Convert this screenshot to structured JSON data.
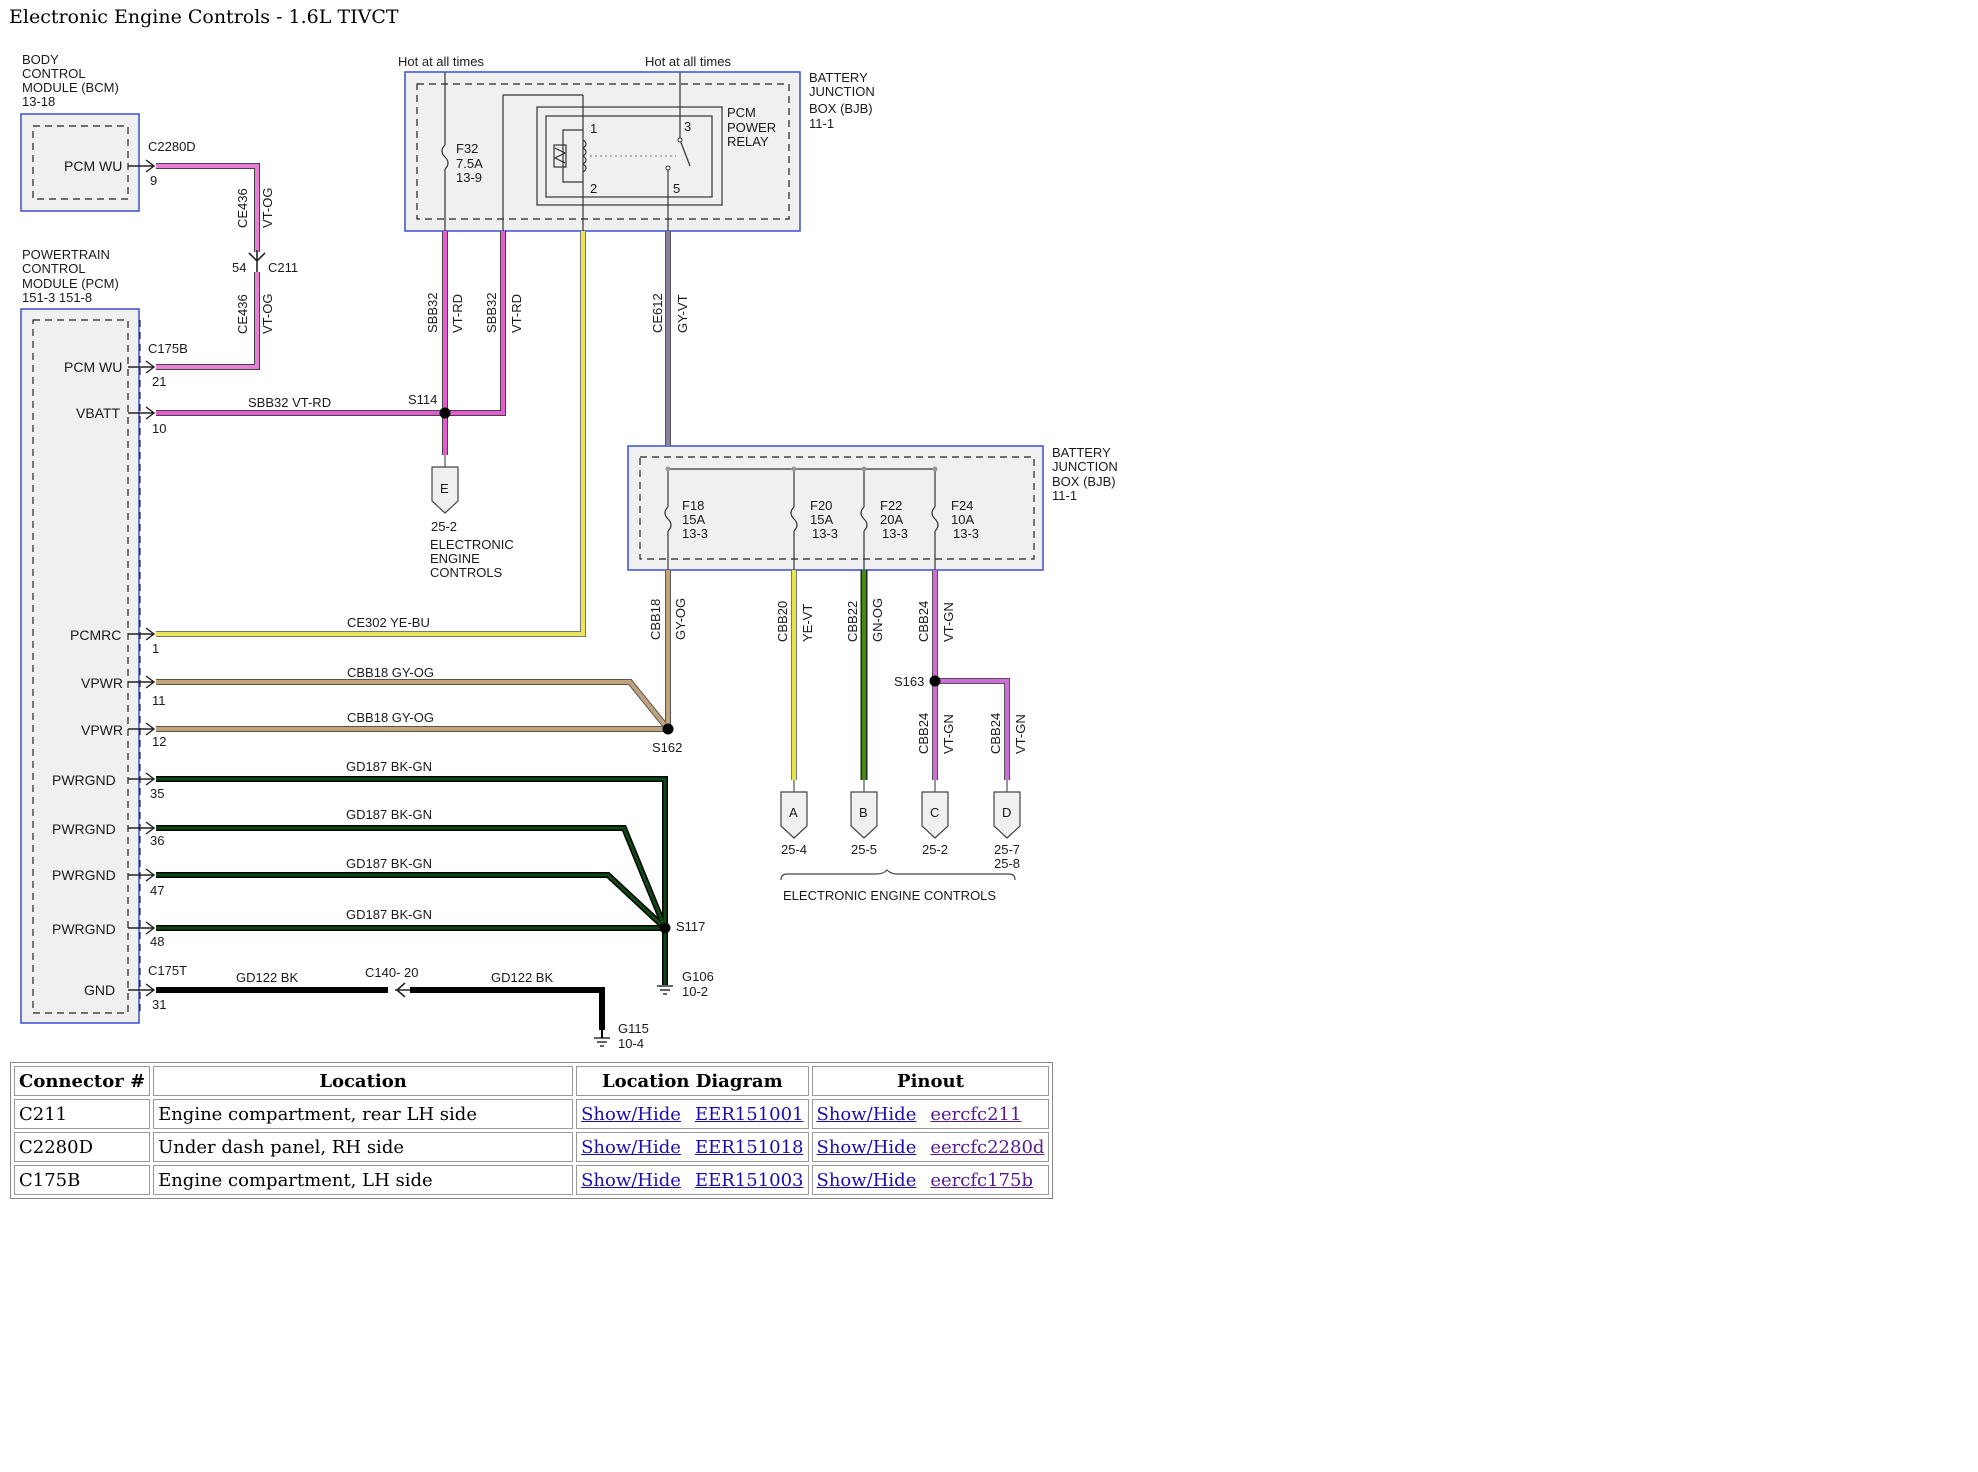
{
  "page_title": "Electronic Engine Controls - 1.6L TIVCT",
  "diagram": {
    "bcm": {
      "name": [
        "BODY",
        "CONTROL",
        "MODULE (BCM)",
        "13-18"
      ],
      "pin": "PCM WU",
      "pin_num": "9",
      "connector": "C2280D"
    },
    "pcm": {
      "name": [
        "POWERTRAIN",
        "CONTROL",
        "MODULE (PCM)",
        "151-3  151-8"
      ],
      "connector_top": "C175B",
      "connector_bottom": "C175T",
      "pins": [
        {
          "label": "PCM WU",
          "num": "21"
        },
        {
          "label": "VBATT",
          "num": "10"
        },
        {
          "label": "PCMRC",
          "num": "1"
        },
        {
          "label": "VPWR",
          "num": "11"
        },
        {
          "label": "VPWR",
          "num": "12"
        },
        {
          "label": "PWRGND",
          "num": "35"
        },
        {
          "label": "PWRGND",
          "num": "36"
        },
        {
          "label": "PWRGND",
          "num": "47"
        },
        {
          "label": "PWRGND",
          "num": "48"
        },
        {
          "label": "GND",
          "num": "31"
        }
      ]
    },
    "c211": {
      "name": "C211",
      "pin": "54"
    },
    "bjb1": {
      "name": [
        "BATTERY",
        "JUNCTION",
        "BOX (BJB)",
        "11-1"
      ],
      "hot1": "Hot at all times",
      "hot2": "Hot at all times",
      "fuse": [
        "F32",
        "7.5A",
        "13-9"
      ],
      "relay": [
        "PCM",
        "POWER",
        "RELAY"
      ],
      "relay_pins": [
        "1",
        "3",
        "2",
        "5"
      ]
    },
    "bjb2": {
      "name": [
        "BATTERY",
        "JUNCTION",
        "BOX (BJB)",
        "11-1"
      ],
      "fuses": [
        [
          "F18",
          "15A",
          "13-3"
        ],
        [
          "F20",
          "15A",
          "13-3"
        ],
        [
          "F22",
          "20A",
          "13-3"
        ],
        [
          "F24",
          "10A",
          "13-3"
        ]
      ]
    },
    "wires": {
      "ce436_a": [
        "CE436",
        "VT-OG"
      ],
      "ce436_b": [
        "CE436",
        "VT-OG"
      ],
      "sbb32_a": [
        "SBB32",
        "VT-RD"
      ],
      "sbb32_b": [
        "SBB32",
        "VT-RD"
      ],
      "ce612": [
        "CE612",
        "GY-VT"
      ],
      "vbatt": "SBB32  VT-RD",
      "pcmrc": "CE302  YE-BU",
      "vpwr1": "CBB18  GY-OG",
      "vpwr2": "CBB18  GY-OG",
      "gnd1": "GD187  BK-GN",
      "gnd2": "GD187  BK-GN",
      "gnd3": "GD187  BK-GN",
      "gnd4": "GD187  BK-GN",
      "gd122_a": "GD122  BK",
      "gd122_b": "GD122  BK",
      "c140": "C140- 20",
      "cbb18": [
        "CBB18",
        "GY-OG"
      ],
      "cbb20": [
        "CBB20",
        "YE-VT"
      ],
      "cbb22": [
        "CBB22",
        "GN-OG"
      ],
      "cbb24_a": [
        "CBB24",
        "VT-GN"
      ],
      "cbb24_b": [
        "CBB24",
        "VT-GN"
      ],
      "cbb24_c": [
        "CBB24",
        "VT-GN"
      ]
    },
    "splices": {
      "s114": "S114",
      "s162": "S162",
      "s163": "S163",
      "s117": "S117"
    },
    "grounds": {
      "g106": [
        "G106",
        "10-2"
      ],
      "g115": [
        "G115",
        "10-4"
      ]
    },
    "refs": {
      "e": {
        "letter": "E",
        "page": "25-2",
        "name": [
          "ELECTRONIC",
          "ENGINE",
          "CONTROLS"
        ]
      },
      "a": {
        "letter": "A",
        "page": "25-4"
      },
      "b": {
        "letter": "B",
        "page": "25-5"
      },
      "c": {
        "letter": "C",
        "page": "25-2"
      },
      "d": {
        "letter": "D",
        "page": [
          "25-7",
          "25-8"
        ]
      },
      "group": "ELECTRONIC ENGINE CONTROLS"
    },
    "colors": {
      "violet_orange": "#e87fd6",
      "violet_red": "#e45ccf",
      "gray_violet": "#8a7f9e",
      "yellow_blue": "#ece35a",
      "gray_orange": "#c4a37a",
      "black_green": "#0d4a12",
      "black": "#000000",
      "yellow_violet": "#e9e342",
      "green_orange": "#3f8e12",
      "violet_green": "#d06cd6",
      "module_border": "#3b4fd4"
    }
  },
  "table": {
    "headers": [
      "Connector #",
      "Location",
      "Location Diagram",
      "Pinout"
    ],
    "rows": [
      {
        "connector": "C211",
        "location": "Engine compartment, rear LH side",
        "show1": "Show/Hide",
        "diagram": "EER151001",
        "show2": "Show/Hide",
        "pinout": "eercfc211"
      },
      {
        "connector": "C2280D",
        "location": "Under dash panel, RH side",
        "show1": "Show/Hide",
        "diagram": "EER151018",
        "show2": "Show/Hide",
        "pinout": "eercfc2280d"
      },
      {
        "connector": "C175B",
        "location": "Engine compartment, LH side",
        "show1": "Show/Hide",
        "diagram": "EER151003",
        "show2": "Show/Hide",
        "pinout": "eercfc175b"
      }
    ]
  }
}
